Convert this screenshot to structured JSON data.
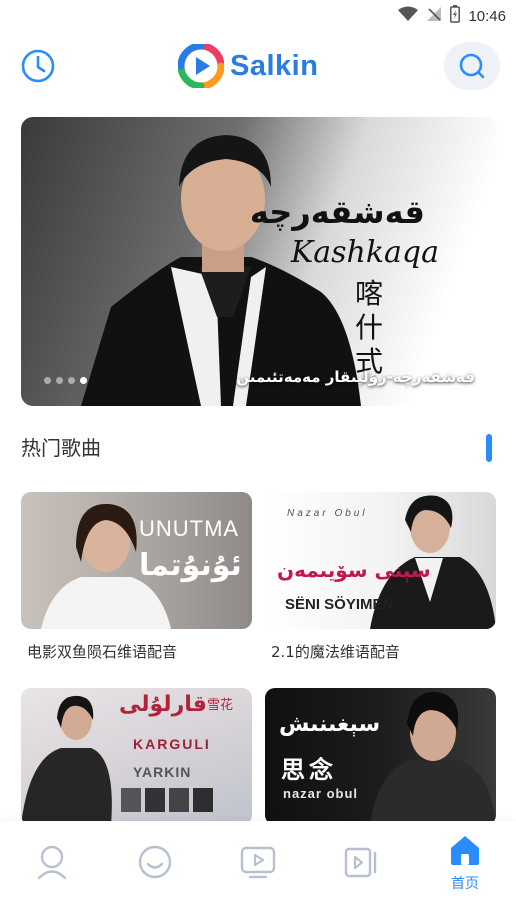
{
  "status_bar": {
    "time": "10:46"
  },
  "header": {
    "brand": "Salkin"
  },
  "banner": {
    "caption": "قەشقەرچە-زۇلپىقار مەمەتئىمىن",
    "art_uyghur": "قەشقەرچە",
    "art_latin": "Kashkaqa",
    "art_hanzi": "喀什式",
    "dots": 4,
    "active_dot": 4
  },
  "section": {
    "title": "热门歌曲"
  },
  "songs": [
    {
      "title": "电影双鱼陨石维语配音",
      "cover_latin": "UNUTMA",
      "cover_uyghur": "ئۇنۇتما"
    },
    {
      "title": "2.1的魔法维语配音",
      "cover_top": "Nazar Obul",
      "cover_uyghur": "سېنى سۆيىمەن",
      "cover_latin": "SËNI SÖYIMEN"
    },
    {
      "title": "",
      "cover_uyghur": "قارلۇلى",
      "cover_latin": "KARGULI",
      "cover_sub": "YARKIN",
      "cover_hanzi": "雪花"
    },
    {
      "title": "",
      "cover_uyghur": "سېغىنىش",
      "cover_hanzi": "思念",
      "cover_latin": "nazar obul"
    }
  ],
  "bottom_nav": {
    "active_label": "首页"
  },
  "colors": {
    "accent": "#2a8cff",
    "brand": "#2a7be4"
  }
}
